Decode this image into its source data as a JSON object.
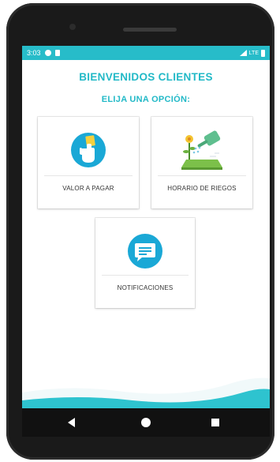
{
  "status_bar": {
    "time": "3:03",
    "network": "LTE",
    "icons": [
      "notification-icon",
      "sim-icon",
      "signal-icon",
      "battery-icon"
    ]
  },
  "header": {
    "title": "BIENVENIDOS CLIENTES",
    "subtitle": "ELIJA UNA OPCIÓN:"
  },
  "options": [
    {
      "label": "VALOR A PAGAR",
      "icon": "hand-pay-icon"
    },
    {
      "label": "HORARIO DE RIEGOS",
      "icon": "watering-plant-icon"
    },
    {
      "label": "NOTIFICACIONES",
      "icon": "chat-message-icon"
    }
  ],
  "colors": {
    "accent": "#22b9c7",
    "status_bar": "#27bcc9",
    "icon_circle": "#1aa8d6",
    "wave": "#2ec3cf",
    "device": "#1a1a1a"
  },
  "nav_bar": {
    "icons": [
      "back-icon",
      "home-icon",
      "recent-apps-icon"
    ]
  }
}
